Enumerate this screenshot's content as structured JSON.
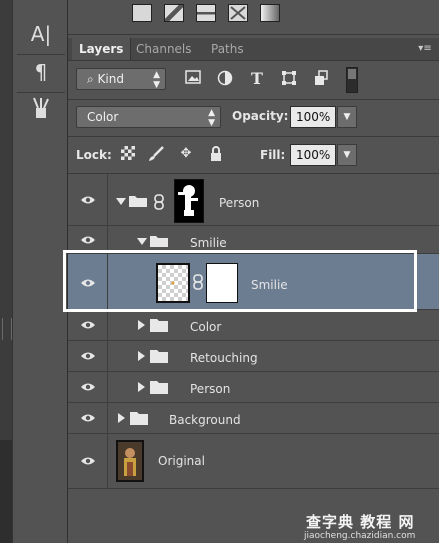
{
  "tabs": [
    "Layers",
    "Channels",
    "Paths"
  ],
  "filter": {
    "kind_label": "Kind",
    "icons": [
      "image-filter-icon",
      "adjustment-filter-icon",
      "type-filter-icon",
      "shape-filter-icon",
      "smart-object-filter-icon"
    ]
  },
  "blend": {
    "mode": "Color",
    "opacity_label": "Opacity:",
    "opacity_value": "100%",
    "lock_label": "Lock:",
    "fill_label": "Fill:",
    "fill_value": "100%"
  },
  "layers": [
    {
      "name": "Person",
      "type": "group",
      "expanded": true,
      "visible": true
    },
    {
      "name": "Smilie",
      "type": "group",
      "expanded": true,
      "visible": true
    },
    {
      "name": "Smilie",
      "type": "layer",
      "selected": true,
      "visible": true
    },
    {
      "name": "Color",
      "type": "group",
      "expanded": false,
      "visible": true
    },
    {
      "name": "Retouching",
      "type": "group",
      "expanded": false,
      "visible": true
    },
    {
      "name": "Person",
      "type": "group",
      "expanded": false,
      "visible": true
    },
    {
      "name": "Background",
      "type": "group",
      "expanded": false,
      "visible": true
    },
    {
      "name": "Original",
      "type": "layer",
      "visible": true
    }
  ],
  "watermark": {
    "title": "查字典 教程 网",
    "url": "jiaocheng.chazidian.com"
  },
  "colors": {
    "panel_bg": "#535353",
    "selected_row": "#6c7d92",
    "highlight_border": "#ffffff"
  }
}
